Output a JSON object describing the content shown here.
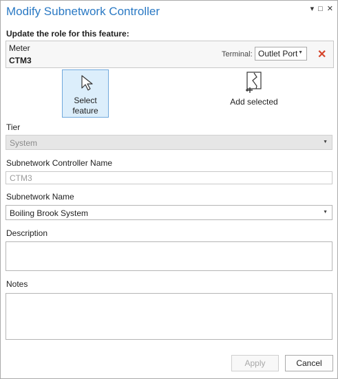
{
  "window": {
    "title": "Modify Subnetwork Controller",
    "ctrl_dropdown": "▾",
    "ctrl_maximize": "□",
    "ctrl_close": "✕"
  },
  "feature_section": {
    "prompt": "Update the role for this feature:",
    "feature_type": "Meter",
    "feature_id": "CTM3",
    "terminal_label": "Terminal:",
    "terminal_value": "Outlet Port",
    "remove_glyph": "✕"
  },
  "tools": {
    "select_feature_label": "Select\nfeature",
    "add_selected_label": "Add selected"
  },
  "form": {
    "tier_label": "Tier",
    "tier_value": "System",
    "controller_name_label": "Subnetwork Controller Name",
    "controller_name_value": "CTM3",
    "subnetwork_name_label": "Subnetwork Name",
    "subnetwork_name_value": "Boiling Brook System",
    "description_label": "Description",
    "description_value": "",
    "notes_label": "Notes",
    "notes_value": ""
  },
  "footer": {
    "apply_label": "Apply",
    "cancel_label": "Cancel"
  },
  "colors": {
    "title_blue": "#2a79c4",
    "remove_red": "#d6452b",
    "selected_tool_bg": "#dceefb"
  }
}
